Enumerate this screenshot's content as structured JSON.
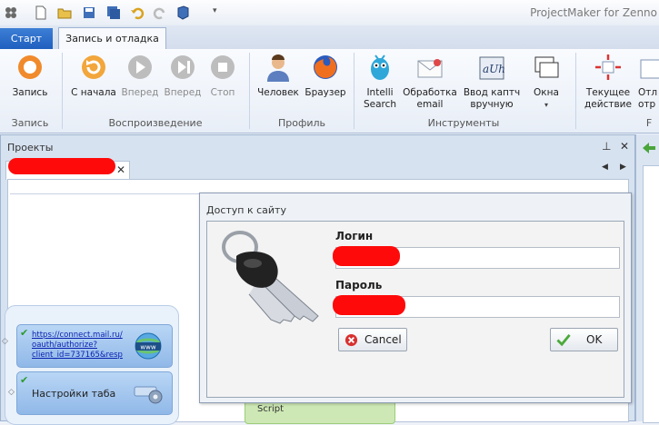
{
  "app": {
    "title": "ProjectMaker for Zenno"
  },
  "tabs": {
    "start": "Старт",
    "active": "Запись и отладка"
  },
  "ribbon": {
    "record": "Запись",
    "restart": "С начала",
    "forward1": "Вперед",
    "forward2": "Вперед",
    "stop": "Стоп",
    "human": "Человек",
    "browser": "Браузер",
    "intelli_1": "Intelli",
    "intelli_2": "Search",
    "email_1": "Обработка",
    "email_2": "email",
    "captcha_1": "Ввод каптч",
    "captcha_2": "вручную",
    "windows": "Окна",
    "current_1": "Текущее",
    "current_2": "действие",
    "extra_1": "Отл",
    "extra_2": "отр",
    "groups": {
      "record": "Запись",
      "playback": "Воспроизведение",
      "profile": "Профиль",
      "tools": "Инструменты",
      "cut": "F"
    }
  },
  "projects": {
    "title": "Проекты"
  },
  "flow": {
    "link_1": "https://connect.mail.ru/",
    "link_2": "oauth/authorize?",
    "link_3": "client_id=737165&resp",
    "tab_settings": "Настройки таба",
    "script": "Script"
  },
  "dialog": {
    "title": "Доступ к сайту",
    "login_label": "Логин",
    "password_label": "Пароль",
    "cancel": "Cancel",
    "ok": "OK"
  },
  "colors": {
    "accent": "#1f5fbf",
    "redaction": "#ff0a0a"
  }
}
